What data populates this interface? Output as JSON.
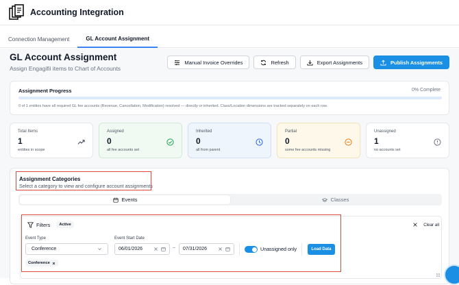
{
  "app": {
    "title": "Accounting Integration"
  },
  "tabs": [
    {
      "label": "Connection Management",
      "active": false
    },
    {
      "label": "GL Account Assignment",
      "active": true
    }
  ],
  "page": {
    "title": "GL Account Assignment",
    "subtitle": "Assign Engagifii items to Chart of Accounts"
  },
  "toolbar": {
    "manual_overrides": "Manual Invoice Overrides",
    "refresh": "Refresh",
    "export": "Export Assignments",
    "publish": "Publish Assignments"
  },
  "progress": {
    "title": "Assignment Progress",
    "percent_label": "0% Complete",
    "percent_value": 0,
    "description": "0 of 1 entities have all required GL fee accounts (Revenue, Cancellation, Modification) resolved — directly or inherited. Class/Location dimensions are tracked separately on each row."
  },
  "stats": [
    {
      "label": "Total Items",
      "value": "1",
      "sub": "entities in scope",
      "icon": "trending-up-icon",
      "bg": "#ffffff",
      "border": "#e5e7eb",
      "icon_color": "#374151"
    },
    {
      "label": "Assigned",
      "value": "0",
      "sub": "all fee accounts set",
      "icon": "check-circle-icon",
      "bg": "#f0faf3",
      "border": "#cfe9d6",
      "icon_color": "#16a34a"
    },
    {
      "label": "Inherited",
      "value": "0",
      "sub": "all from parent",
      "icon": "clock-icon",
      "bg": "#eff5fd",
      "border": "#cfdff5",
      "icon_color": "#2563eb"
    },
    {
      "label": "Partial",
      "value": "0",
      "sub": "some fee accounts missing",
      "icon": "minus-circle-icon",
      "bg": "#fdf8ea",
      "border": "#f1e4b8",
      "icon_color": "#ea7a1a"
    },
    {
      "label": "Unassigned",
      "value": "1",
      "sub": "no accounts set",
      "icon": "alert-circle-icon",
      "bg": "#ffffff",
      "border": "#e5e7eb",
      "icon_color": "#6b7280"
    }
  ],
  "categories": {
    "title": "Assignment Categories",
    "subtitle": "Select a category to view and configure account assignments",
    "segments": [
      {
        "label": "Events",
        "active": true,
        "icon": "calendar-icon"
      },
      {
        "label": "Classes",
        "active": false,
        "icon": "graduation-cap-icon"
      }
    ]
  },
  "filters": {
    "title": "Filters",
    "badge": "Active",
    "clear_all": "Clear all",
    "event_type_label": "Event Type",
    "event_type_value": "Conference",
    "start_date_label": "Event Start Date",
    "date_from": "06/01/2026",
    "date_to": "07/31/2026",
    "dash": "–",
    "unassigned_only": "Unassigned only",
    "load_data": "Load Data",
    "chips": [
      "Conference"
    ]
  },
  "colors": {
    "primary": "#1a8fe3",
    "highlight_border": "#e04a3a"
  }
}
